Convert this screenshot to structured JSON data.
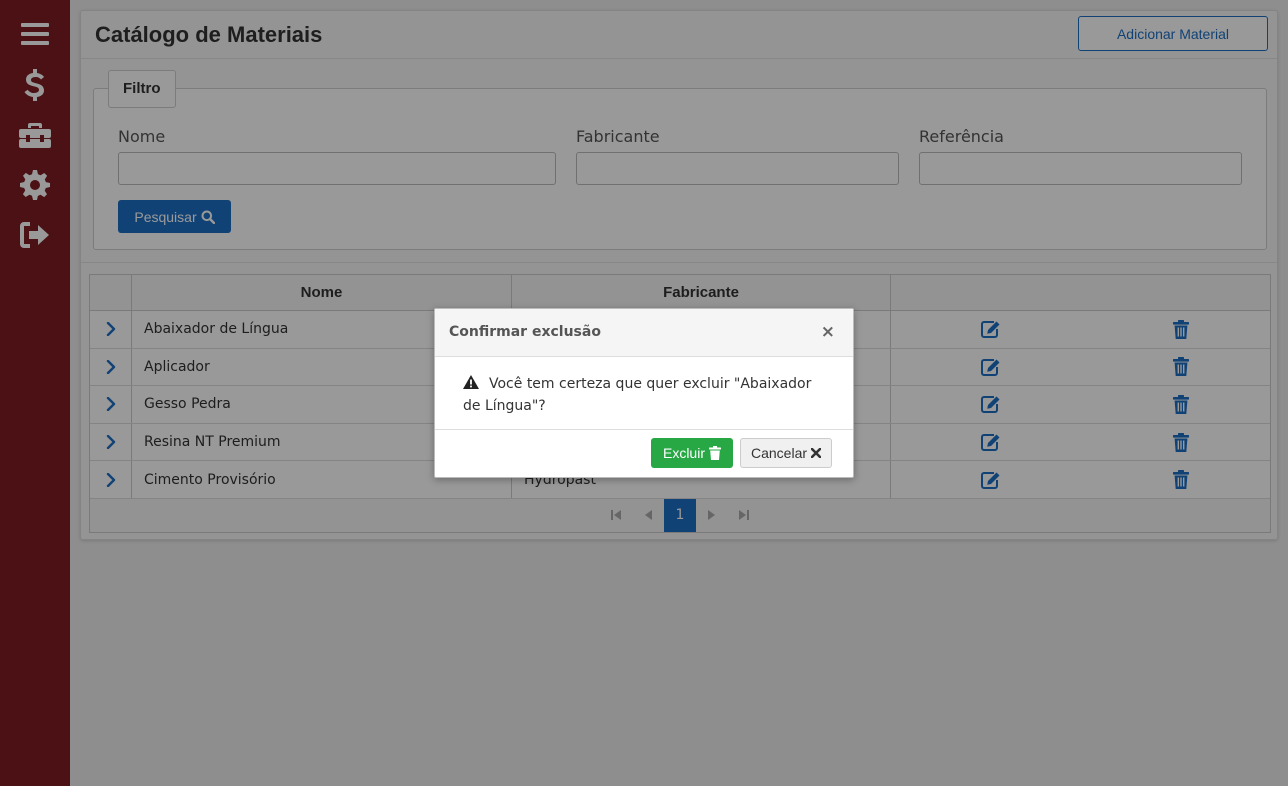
{
  "sidebar": {
    "items": [
      {
        "icon": "menu-icon"
      },
      {
        "icon": "dollar-icon"
      },
      {
        "icon": "toolbox-icon"
      },
      {
        "icon": "gear-icon"
      },
      {
        "icon": "logout-icon"
      }
    ]
  },
  "header": {
    "title": "Catálogo de Materiais",
    "add_button": "Adicionar Material"
  },
  "filter": {
    "legend": "Filtro",
    "nome_label": "Nome",
    "fabricante_label": "Fabricante",
    "referencia_label": "Referência",
    "nome_value": "",
    "fabricante_value": "",
    "referencia_value": "",
    "search_button": "Pesquisar"
  },
  "table": {
    "headers": {
      "nome": "Nome",
      "fabricante": "Fabricante"
    },
    "rows": [
      {
        "nome": "Abaixador de Língua",
        "fabricante": ""
      },
      {
        "nome": "Aplicador",
        "fabricante": ""
      },
      {
        "nome": "Gesso Pedra",
        "fabricante": ""
      },
      {
        "nome": "Resina NT Premium",
        "fabricante": ""
      },
      {
        "nome": "Cimento Provisório",
        "fabricante": "Hydropast"
      }
    ]
  },
  "pagination": {
    "current_page": "1"
  },
  "modal": {
    "title": "Confirmar exclusão",
    "close": "×",
    "message": "Você tem certeza que quer excluir \"Abaixador de Língua\"?",
    "confirm_button": "Excluir",
    "cancel_button": "Cancelar"
  },
  "colors": {
    "sidebar": "#7d1d22",
    "primary": "#1d6fc4",
    "success": "#28a745"
  }
}
